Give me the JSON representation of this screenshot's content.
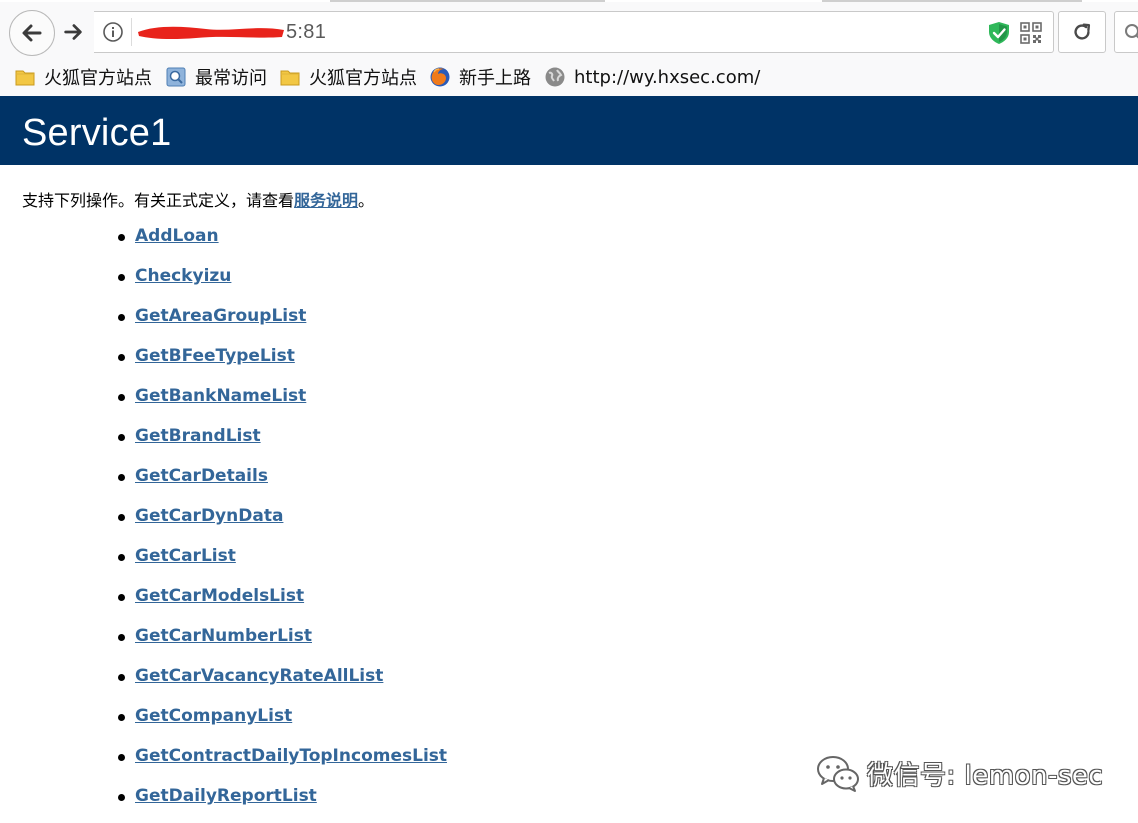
{
  "browser": {
    "address_bar": {
      "visible_suffix": "5:81"
    },
    "bookmarks": [
      {
        "label": "火狐官方站点",
        "icon": "folder-icon"
      },
      {
        "label": "最常访问",
        "icon": "most-visited-icon"
      },
      {
        "label": "火狐官方站点",
        "icon": "folder-icon"
      },
      {
        "label": "新手上路",
        "icon": "firefox-icon"
      },
      {
        "label": "http://wy.hxsec.com/",
        "icon": "globe-icon"
      }
    ],
    "colors": {
      "shield": "#2fb85a",
      "redaction": "#e8231b"
    }
  },
  "page": {
    "title": "Service1",
    "intro_text": "支持下列操作。有关正式定义，请查看",
    "intro_link": "服务说明",
    "intro_end": "。",
    "operations": [
      "AddLoan",
      "Checkyizu",
      "GetAreaGroupList",
      "GetBFeeTypeList",
      "GetBankNameList",
      "GetBrandList",
      "GetCarDetails",
      "GetCarDynData",
      "GetCarList",
      "GetCarModelsList",
      "GetCarNumberList",
      "GetCarVacancyRateAllList",
      "GetCompanyList",
      "GetContractDailyTopIncomesList",
      "GetDailyReportList"
    ],
    "colors": {
      "header_bg": "#003366",
      "link": "#336699"
    }
  },
  "watermark": {
    "text": "微信号: lemon-sec"
  }
}
